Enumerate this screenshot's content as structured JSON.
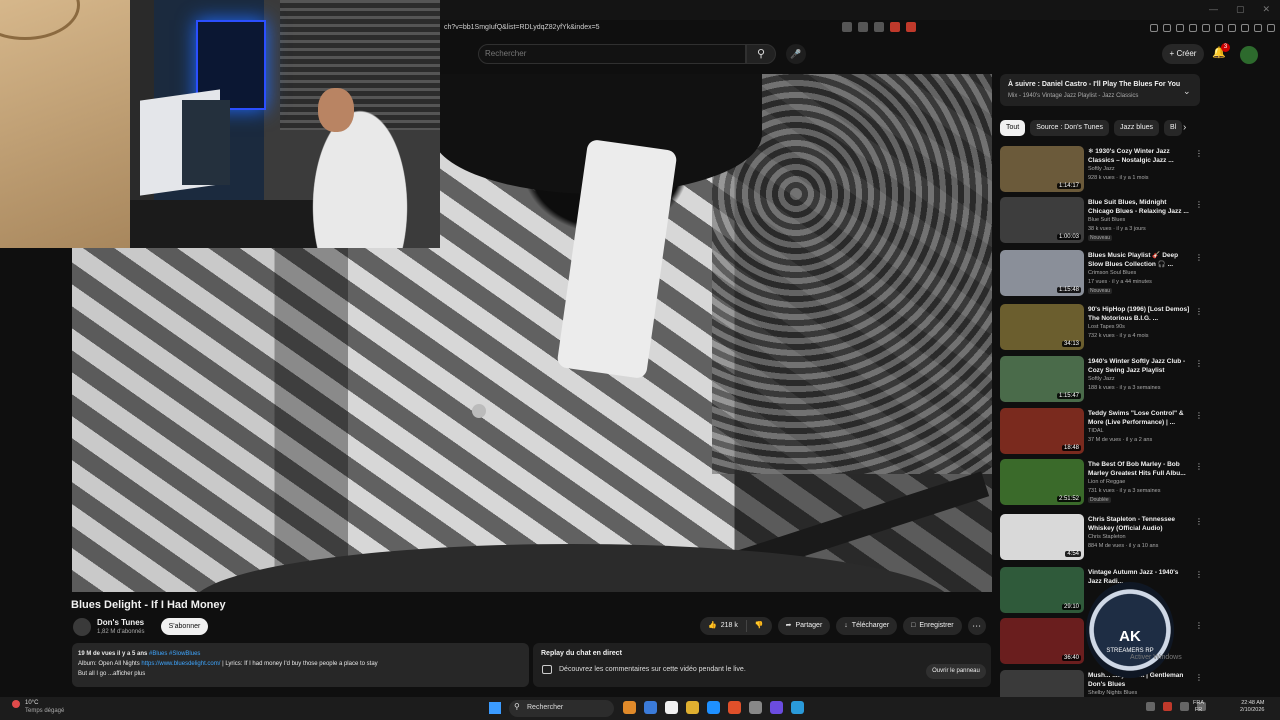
{
  "browser": {
    "url": "ch?v=bb1SmgIufQ&list=RDLydqZ82yfYk&index=5"
  },
  "header": {
    "search_placeholder": "Rechercher",
    "create_label": "Créer",
    "notif_count": "3"
  },
  "video": {
    "title": "Blues Delight - If I Had Money",
    "channel": "Don's Tunes",
    "subscribers": "1,82 M d'abonnés",
    "subscribe_label": "S'abonner",
    "likes": "218 k",
    "share_label": "Partager",
    "download_label": "Télécharger",
    "save_label": "Enregistrer"
  },
  "description": {
    "meta": "19 M de vues  il y a 5 ans",
    "tags": "#Blues #SlowBlues",
    "line1_prefix": "Album: Open All Nights ",
    "line1_link": "https://www.bluesdelight.com/",
    "line1_suffix": " | Lyrics:  If I had money I'd buy those people a place to stay",
    "line2": "But all I go ...afficher plus"
  },
  "chat": {
    "title": "Replay du chat en direct",
    "text": "Découvrez les commentaires sur cette vidéo pendant le live.",
    "button": "Ouvrir le panneau"
  },
  "upnext": {
    "title": "À suivre : Daniel Castro - I'll Play The Blues For You",
    "subtitle": "Mix - 1940's Vintage Jazz Playlist - Jazz Classics"
  },
  "chips": [
    "Tout",
    "Source : Don's Tunes",
    "Jazz blues",
    "Bl"
  ],
  "recommendations": [
    {
      "title": "❄ 1930's Cozy Winter Jazz Classics – Nostalgic Jazz ...",
      "channel": "Softly Jazz",
      "meta": "928 k vues · il y a 1 mois",
      "badge": "",
      "duration": "1:14:17",
      "color": "#6b5a3a"
    },
    {
      "title": "Blue Suit Blues, Midnight Chicago Blues - Relaxing Jazz ...",
      "channel": "Blue Suit Blues",
      "meta": "38 k vues · il y a 3 jours",
      "badge": "Nouveau",
      "duration": "1:00:03",
      "color": "#3d3d3d"
    },
    {
      "title": "Blues Music Playlist 🎸 Deep Slow Blues Collection 🎧 ...",
      "channel": "Crimson Soul Blues",
      "meta": "17 vues · il y a 44 minutes",
      "badge": "Nouveau",
      "duration": "1:15:48",
      "color": "#8a8f99"
    },
    {
      "title": "90's HipHop (1996) [Lost Demos] The Notorious B.I.G. ...",
      "channel": "Lost Tapes 90s",
      "meta": "732 k vues · il y a 4 mois",
      "badge": "",
      "duration": "34:13",
      "color": "#6b5e2e"
    },
    {
      "title": "1940's Winter Softly Jazz Club - Cozy Swing Jazz Playlist",
      "channel": "Softly Jazz",
      "meta": "188 k vues · il y a 3 semaines",
      "badge": "",
      "duration": "1:15:47",
      "color": "#4a6b4a"
    },
    {
      "title": "Teddy Swims \"Lose Control\" & More (Live Performance) | ...",
      "channel": "TIDAL",
      "meta": "37 M de vues · il y a 2 ans",
      "badge": "",
      "duration": "18:48",
      "color": "#7a2a1e"
    },
    {
      "title": "The Best Of Bob Marley - Bob Marley Greatest Hits Full Albu...",
      "channel": "Lion of Reggae",
      "meta": "731 k vues · il y a 3 semaines",
      "badge": "Doublée",
      "duration": "2:51:52",
      "color": "#3a6a2a"
    },
    {
      "title": "Chris Stapleton - Tennessee Whiskey (Official Audio)",
      "channel": "Chris Stapleton",
      "meta": "884 M de vues · il y a 10 ans",
      "badge": "",
      "duration": "4:54",
      "color": "#d9d9d9"
    },
    {
      "title": "Vintage Autumn Jazz - 1940's Jazz Radi...",
      "channel": "",
      "meta": "",
      "badge": "",
      "duration": "29:10",
      "color": "#2f5a3a"
    },
    {
      "title": "",
      "channel": "",
      "meta": "",
      "badge": "",
      "duration": "36:40",
      "color": "#6a1e1e"
    },
    {
      "title": "Mush... ...ay Silent | Gentleman Don's Blues",
      "channel": "Shelby Nights Blues",
      "meta": "",
      "badge": "",
      "duration": "",
      "color": "#3a3a3a"
    }
  ],
  "watermark": {
    "text": "AK",
    "sub": "STREAMERS RP",
    "activate": "Activer Windows"
  },
  "taskbar": {
    "weather_temp": "10°C",
    "weather_desc": "Temps dégagé",
    "search": "Rechercher",
    "lang1": "FRA",
    "lang2": "FR",
    "time": "22:48 AM",
    "date": "2/10/2026"
  }
}
